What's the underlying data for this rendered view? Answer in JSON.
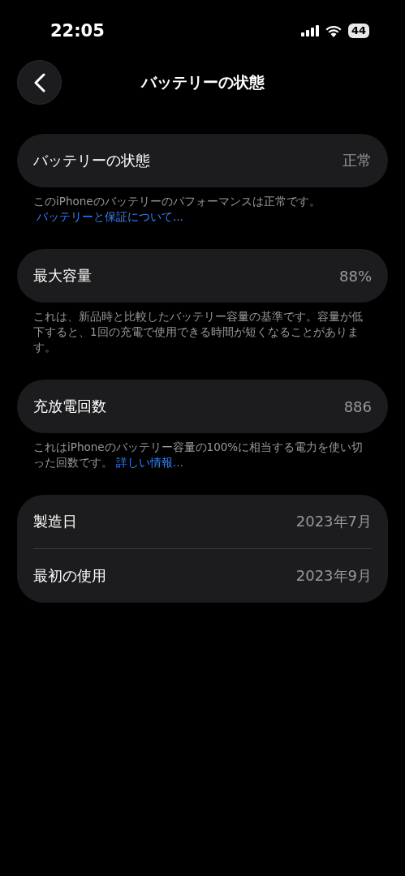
{
  "status_bar": {
    "time": "22:05",
    "battery": "44"
  },
  "nav": {
    "title": "バッテリーの状態"
  },
  "sections": [
    {
      "rows": [
        {
          "label": "バッテリーの状態",
          "value": "正常"
        }
      ],
      "footer": {
        "text": "このiPhoneのバッテリーのパフォーマンスは正常です。",
        "link": "バッテリーと保証について..."
      }
    },
    {
      "rows": [
        {
          "label": "最大容量",
          "value": "88%"
        }
      ],
      "footer": {
        "text": "これは、新品時と比較したバッテリー容量の基準です。容量が低下すると、1回の充電で使用できる時間が短くなることがあります。"
      }
    },
    {
      "rows": [
        {
          "label": "充放電回数",
          "value": "886"
        }
      ],
      "footer": {
        "text": "これはiPhoneのバッテリー容量の100%に相当する電力を使い切った回数です。",
        "link": "詳しい情報..."
      }
    },
    {
      "rows": [
        {
          "label": "製造日",
          "value": "2023年7月"
        },
        {
          "label": "最初の使用",
          "value": "2023年9月"
        }
      ]
    }
  ]
}
